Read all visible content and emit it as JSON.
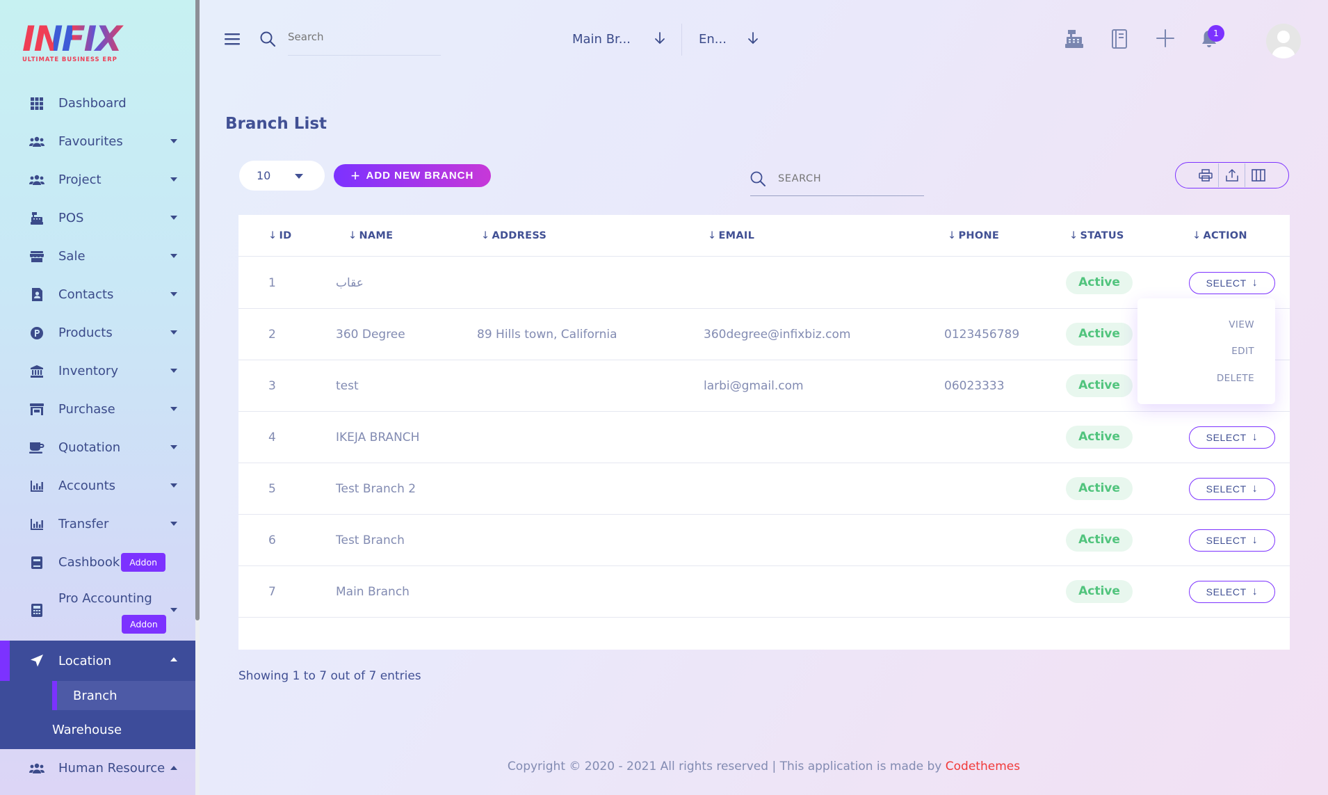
{
  "logo": {
    "word": "INFIX",
    "tagline": "ULTIMATE BUSINESS ERP"
  },
  "sidebar": {
    "items": [
      {
        "label": "Dashboard",
        "icon": "grid-icon",
        "caret": false
      },
      {
        "label": "Favourites",
        "icon": "users-icon",
        "caret": true
      },
      {
        "label": "Project",
        "icon": "users-icon",
        "caret": true
      },
      {
        "label": "POS",
        "icon": "cash-register-icon",
        "caret": true
      },
      {
        "label": "Sale",
        "icon": "store-icon",
        "caret": true
      },
      {
        "label": "Contacts",
        "icon": "contact-book-icon",
        "caret": true
      },
      {
        "label": "Products",
        "icon": "product-p-icon",
        "caret": true
      },
      {
        "label": "Inventory",
        "icon": "bank-icon",
        "caret": true
      },
      {
        "label": "Purchase",
        "icon": "shop-icon",
        "caret": true
      },
      {
        "label": "Quotation",
        "icon": "coffee-icon",
        "caret": true
      },
      {
        "label": "Accounts",
        "icon": "bar-chart-icon",
        "caret": true
      },
      {
        "label": "Transfer",
        "icon": "bar-chart-icon",
        "caret": true
      }
    ],
    "cashbook": {
      "label": "Cashbook",
      "addon": "Addon"
    },
    "pro_accounting": {
      "label": "Pro Accounting",
      "addon": "Addon"
    },
    "location": {
      "label": "Location"
    },
    "branch": {
      "label": "Branch"
    },
    "warehouse": {
      "label": "Warehouse"
    },
    "human_resource": {
      "label": "Human Resource"
    }
  },
  "topbar": {
    "search_placeholder": "Search",
    "branch_select": "Main Br...",
    "language_select": "En...",
    "notification_count": "1"
  },
  "page": {
    "title": "Branch List",
    "per_page": "10",
    "add_button": "ADD NEW BRANCH",
    "search_placeholder": "SEARCH",
    "showing": "Showing 1 to 7 out of 7 entries"
  },
  "table": {
    "arrow": "↓",
    "columns": [
      "ID",
      "NAME",
      "ADDRESS",
      "EMAIL",
      "PHONE",
      "STATUS",
      "ACTION"
    ],
    "rows": [
      {
        "id": "1",
        "name": "عقاب",
        "address": "",
        "email": "",
        "phone": "",
        "status": "Active",
        "action": "SELECT"
      },
      {
        "id": "2",
        "name": "360 Degree",
        "address": "89 Hills town, California",
        "email": "360degree@infixbiz.com",
        "phone": "0123456789",
        "status": "Active",
        "action": ""
      },
      {
        "id": "3",
        "name": "test",
        "address": "",
        "email": "larbi@gmail.com",
        "phone": "06023333",
        "status": "Active",
        "action": ""
      },
      {
        "id": "4",
        "name": "IKEJA BRANCH",
        "address": "",
        "email": "",
        "phone": "",
        "status": "Active",
        "action": "SELECT"
      },
      {
        "id": "5",
        "name": "Test Branch 2",
        "address": "",
        "email": "",
        "phone": "",
        "status": "Active",
        "action": "SELECT"
      },
      {
        "id": "6",
        "name": "Test Branch",
        "address": "",
        "email": "",
        "phone": "",
        "status": "Active",
        "action": "SELECT"
      },
      {
        "id": "7",
        "name": "Main Branch",
        "address": "",
        "email": "",
        "phone": "",
        "status": "Active",
        "action": "SELECT"
      }
    ]
  },
  "dropdown": {
    "view": "VIEW",
    "edit": "EDIT",
    "delete": "DELETE"
  },
  "footer": {
    "text": "Copyright © 2020 - 2021 All rights reserved | This application is made by ",
    "brand": "Codethemes"
  },
  "colors": {
    "accent": "#7c32ff",
    "primary_text": "#415094",
    "status_green": "#51c47d",
    "brand_red": "#f13939",
    "sidebar_active": "#3d4c9a"
  }
}
